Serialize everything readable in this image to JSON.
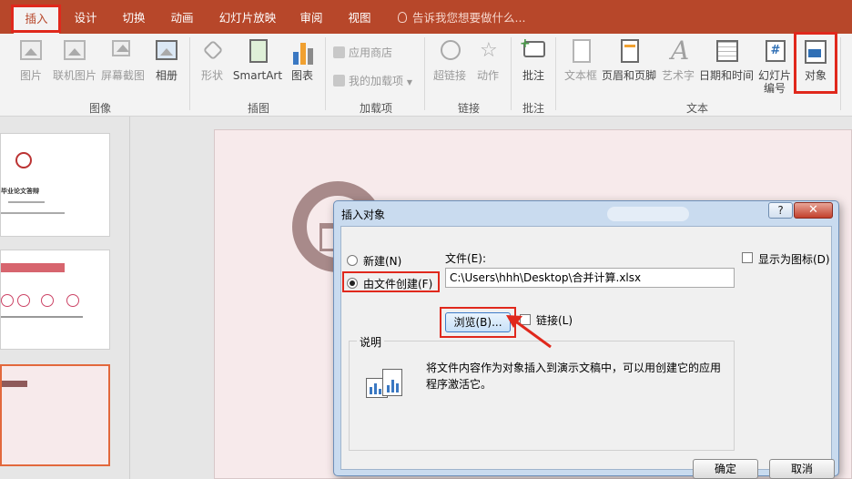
{
  "tabs": [
    {
      "label": "插入",
      "active": true
    },
    {
      "label": "设计"
    },
    {
      "label": "切换"
    },
    {
      "label": "动画"
    },
    {
      "label": "幻灯片放映"
    },
    {
      "label": "审阅"
    },
    {
      "label": "视图"
    }
  ],
  "tell_me": "告诉我您想要做什么...",
  "ribbon": {
    "images": {
      "label": "图像",
      "picture": "图片",
      "online_picture": "联机图片",
      "screenshot": "屏幕截图",
      "album": "相册"
    },
    "illustrations": {
      "label": "插图",
      "shapes": "形状",
      "smartart": "SmartArt",
      "chart": "图表"
    },
    "addins": {
      "label": "加载项",
      "store": "应用商店",
      "my_addins": "我的加载项"
    },
    "links": {
      "label": "链接",
      "hyperlink": "超链接",
      "action": "动作"
    },
    "comments": {
      "label": "批注",
      "comment": "批注"
    },
    "text": {
      "label": "文本",
      "textbox": "文本框",
      "header_footer": "页眉和页脚",
      "wordart": "艺术字",
      "datetime": "日期和时间",
      "slide_number": "幻灯片",
      "slide_number_line2": "编号",
      "object": "对象"
    },
    "colors": {
      "accent": "#b7472a",
      "highlight": "#e0281c"
    }
  },
  "thumbnails": {
    "slide1_title": "毕业论文答辩"
  },
  "dialog": {
    "title": "插入对象",
    "help": "?",
    "close": "✕",
    "create_new": "新建(N)",
    "create_from_file": "由文件创建(F)",
    "file_label": "文件(E):",
    "file_path": "C:\\Users\\hhh\\Desktop\\合并计算.xlsx",
    "browse": "浏览(B)...",
    "link": "链接(L)",
    "display_as_icon": "显示为图标(D)",
    "description_title": "说明",
    "description_text": "将文件内容作为对象插入到演示文稿中，可以用创建它的应用程序激活它。",
    "ok": "确定",
    "cancel": "取消"
  }
}
